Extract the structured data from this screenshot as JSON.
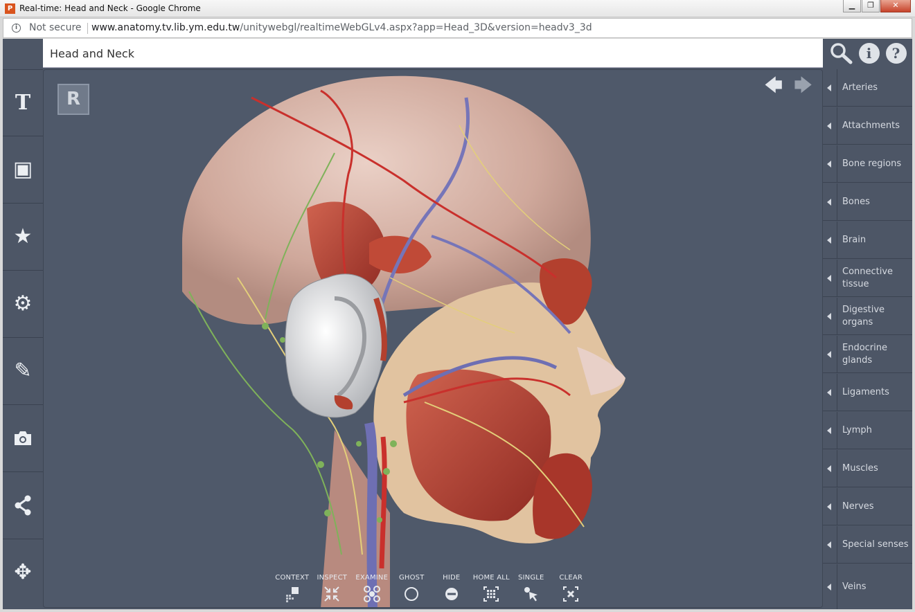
{
  "window": {
    "title": "Real-time: Head and Neck - Google Chrome",
    "app_icon_letter": "P",
    "minimize": "▁",
    "maximize": "❐",
    "close": "✕"
  },
  "address_bar": {
    "security_text": "Not secure",
    "url_host": "www.anatomy.tv.lib.ym.edu.tw",
    "url_path": "/unitywebgl/realtimeWebGLv4.aspx?app=Head_3D&version=headv3_3d"
  },
  "header": {
    "title": "Head and Neck",
    "info_glyph": "i",
    "help_glyph": "?"
  },
  "left_toolbar": {
    "items": [
      {
        "name": "text-tool",
        "glyph": "T"
      },
      {
        "name": "frame-tool",
        "glyph": "▣"
      },
      {
        "name": "favorites",
        "glyph": "★"
      },
      {
        "name": "settings",
        "glyph": "⚙"
      },
      {
        "name": "draw-tool",
        "glyph": "✎"
      },
      {
        "name": "camera",
        "glyph": "📷"
      },
      {
        "name": "share",
        "glyph": "⋖"
      },
      {
        "name": "move",
        "glyph": "✥"
      }
    ]
  },
  "viewport": {
    "badge": "R",
    "back_arrow": "🡄",
    "forward_arrow": "🡆"
  },
  "bottom_tools": [
    {
      "label": "CONTEXT"
    },
    {
      "label": "INSPECT"
    },
    {
      "label": "EXAMINE"
    },
    {
      "label": "GHOST"
    },
    {
      "label": "HIDE"
    },
    {
      "label": "HOME ALL"
    },
    {
      "label": "SINGLE"
    },
    {
      "label": "CLEAR"
    }
  ],
  "systems": [
    {
      "label": "Arteries"
    },
    {
      "label": "Attachments"
    },
    {
      "label": "Bone regions"
    },
    {
      "label": "Bones"
    },
    {
      "label": "Brain"
    },
    {
      "label": "Connective tissue"
    },
    {
      "label": "Digestive organs"
    },
    {
      "label": "Endocrine glands"
    },
    {
      "label": "Ligaments"
    },
    {
      "label": "Lymph"
    },
    {
      "label": "Muscles"
    },
    {
      "label": "Nerves"
    },
    {
      "label": "Special senses"
    },
    {
      "label": "Veins"
    }
  ],
  "colors": {
    "panel": "#4d5666",
    "viewport": "#4f596a",
    "skin": "#d7b8ab",
    "muscle": "#b4402f",
    "artery": "#c9302c",
    "vein": "#6e6fb3",
    "nerve": "#e3cf7a",
    "lymph": "#7fb25a"
  }
}
